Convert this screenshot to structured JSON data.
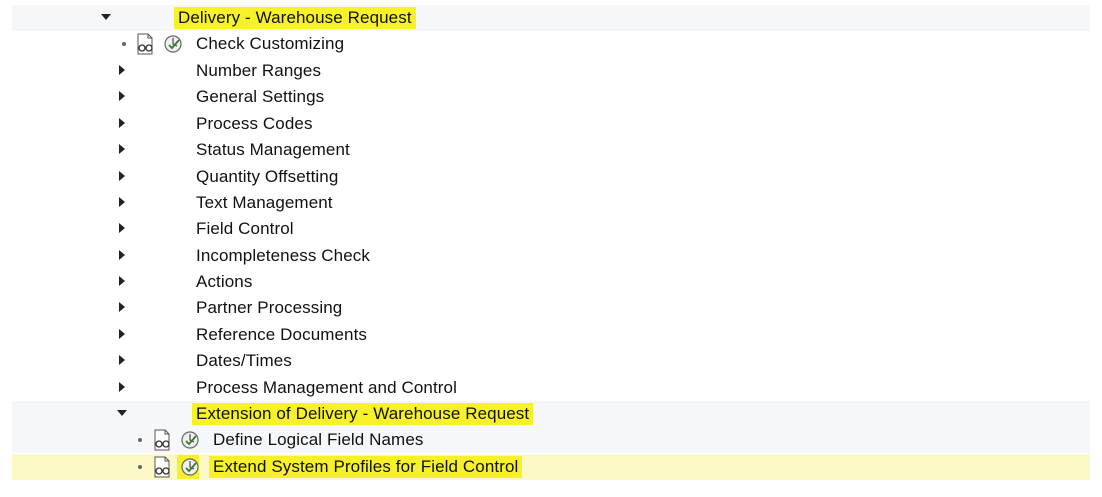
{
  "tree": {
    "root": {
      "label": "Delivery - Warehouse Request",
      "expanded": true,
      "highlighted": true
    },
    "children": [
      {
        "label": "Check Customizing",
        "type": "activity"
      },
      {
        "label": "Number Ranges",
        "type": "folder"
      },
      {
        "label": "General Settings",
        "type": "folder"
      },
      {
        "label": "Process Codes",
        "type": "folder"
      },
      {
        "label": "Status Management",
        "type": "folder"
      },
      {
        "label": "Quantity Offsetting",
        "type": "folder"
      },
      {
        "label": "Text Management",
        "type": "folder"
      },
      {
        "label": "Field Control",
        "type": "folder"
      },
      {
        "label": "Incompleteness Check",
        "type": "folder"
      },
      {
        "label": "Actions",
        "type": "folder"
      },
      {
        "label": "Partner Processing",
        "type": "folder"
      },
      {
        "label": "Reference Documents",
        "type": "folder"
      },
      {
        "label": "Dates/Times",
        "type": "folder"
      },
      {
        "label": "Process Management and Control",
        "type": "folder"
      }
    ],
    "extension": {
      "label": "Extension of Delivery - Warehouse Request",
      "expanded": true,
      "highlighted": true,
      "children": [
        {
          "label": "Define Logical Field Names",
          "type": "activity"
        },
        {
          "label": "Extend System Profiles for Field Control",
          "type": "activity",
          "selected": true,
          "highlighted": true
        }
      ]
    }
  },
  "icons": {
    "expanded": "triangle-down-icon",
    "collapsed": "triangle-right-icon",
    "documentation": "glasses-document-icon",
    "execute": "execute-clock-icon"
  },
  "colors": {
    "highlight": "#f7f12a",
    "selected_row": "#fbf9c6",
    "row_background": "#f6f7f9"
  }
}
